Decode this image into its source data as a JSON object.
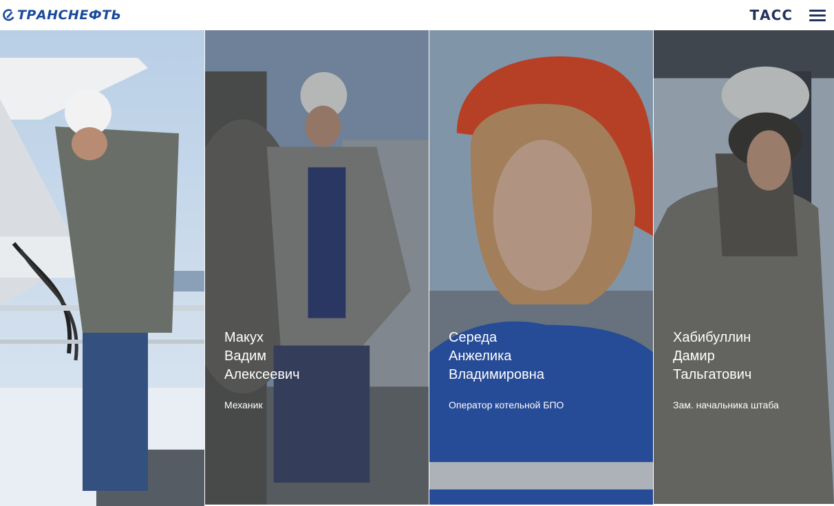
{
  "header": {
    "brand": "ТРАНСНЕФТЬ",
    "partner": "ТАСС"
  },
  "colors": {
    "brand_blue": "#1a4a9c",
    "tass_navy": "#22325c"
  },
  "people": [
    {
      "name_line1": "",
      "name_line2": "",
      "name_line3": "",
      "role": ""
    },
    {
      "name_line1": "Макух",
      "name_line2": "Вадим",
      "name_line3": "Алексеевич",
      "role": "Механик"
    },
    {
      "name_line1": "Середа",
      "name_line2": "Анжелика",
      "name_line3": "Владимировна",
      "role": "Оператор котельной БПО"
    },
    {
      "name_line1": "Хабибуллин",
      "name_line2": "Дамир",
      "name_line3": "Тальгатович",
      "role": "Зам. начальника штаба"
    }
  ]
}
